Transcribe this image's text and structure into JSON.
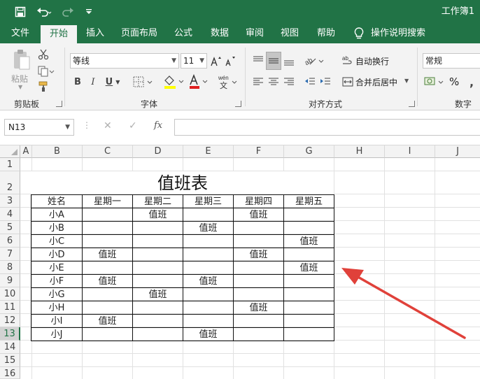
{
  "titlebar": {
    "doc_title": "工作簿1",
    "save_icon": "save-icon",
    "undo_icon": "undo-icon",
    "redo_icon": "redo-icon",
    "customize_icon": "customize-qat-icon"
  },
  "ribbon_tabs": [
    "文件",
    "开始",
    "插入",
    "页面布局",
    "公式",
    "数据",
    "审阅",
    "视图",
    "帮助",
    "操作说明搜索"
  ],
  "ribbon": {
    "clipboard": {
      "paste_label": "粘贴",
      "group_label": "剪贴板"
    },
    "font": {
      "font_name": "等线",
      "font_size": "11",
      "group_label": "字体"
    },
    "alignment": {
      "wrap_label": "自动换行",
      "merge_label": "合并后居中",
      "group_label": "对齐方式"
    },
    "number": {
      "format": "常规",
      "percent": "%",
      "group_label": "数字"
    }
  },
  "formula_bar": {
    "name_box": "N13",
    "fx": "fx",
    "value": ""
  },
  "columns": [
    "A",
    "B",
    "C",
    "D",
    "E",
    "F",
    "G",
    "H",
    "I",
    "J"
  ],
  "rows": [
    "1",
    "2",
    "3",
    "4",
    "5",
    "6",
    "7",
    "8",
    "9",
    "10",
    "11",
    "12",
    "13",
    "14",
    "15",
    "16"
  ],
  "sheet": {
    "title": "值班表",
    "headers": [
      "姓名",
      "星期一",
      "星期二",
      "星期三",
      "星期四",
      "星期五"
    ],
    "rows": [
      [
        "小A",
        "",
        "值班",
        "",
        "值班",
        ""
      ],
      [
        "小B",
        "",
        "",
        "值班",
        "",
        ""
      ],
      [
        "小C",
        "",
        "",
        "",
        "",
        "值班"
      ],
      [
        "小D",
        "值班",
        "",
        "",
        "值班",
        ""
      ],
      [
        "小E",
        "",
        "",
        "",
        "",
        "值班"
      ],
      [
        "小F",
        "值班",
        "",
        "值班",
        "",
        ""
      ],
      [
        "小G",
        "",
        "值班",
        "",
        "",
        ""
      ],
      [
        "小H",
        "",
        "",
        "",
        "值班",
        ""
      ],
      [
        "小I",
        "值班",
        "",
        "",
        "",
        ""
      ],
      [
        "小J",
        "",
        "",
        "值班",
        "",
        ""
      ]
    ]
  },
  "colors": {
    "accent": "#217346",
    "arrow": "#e0413a"
  }
}
